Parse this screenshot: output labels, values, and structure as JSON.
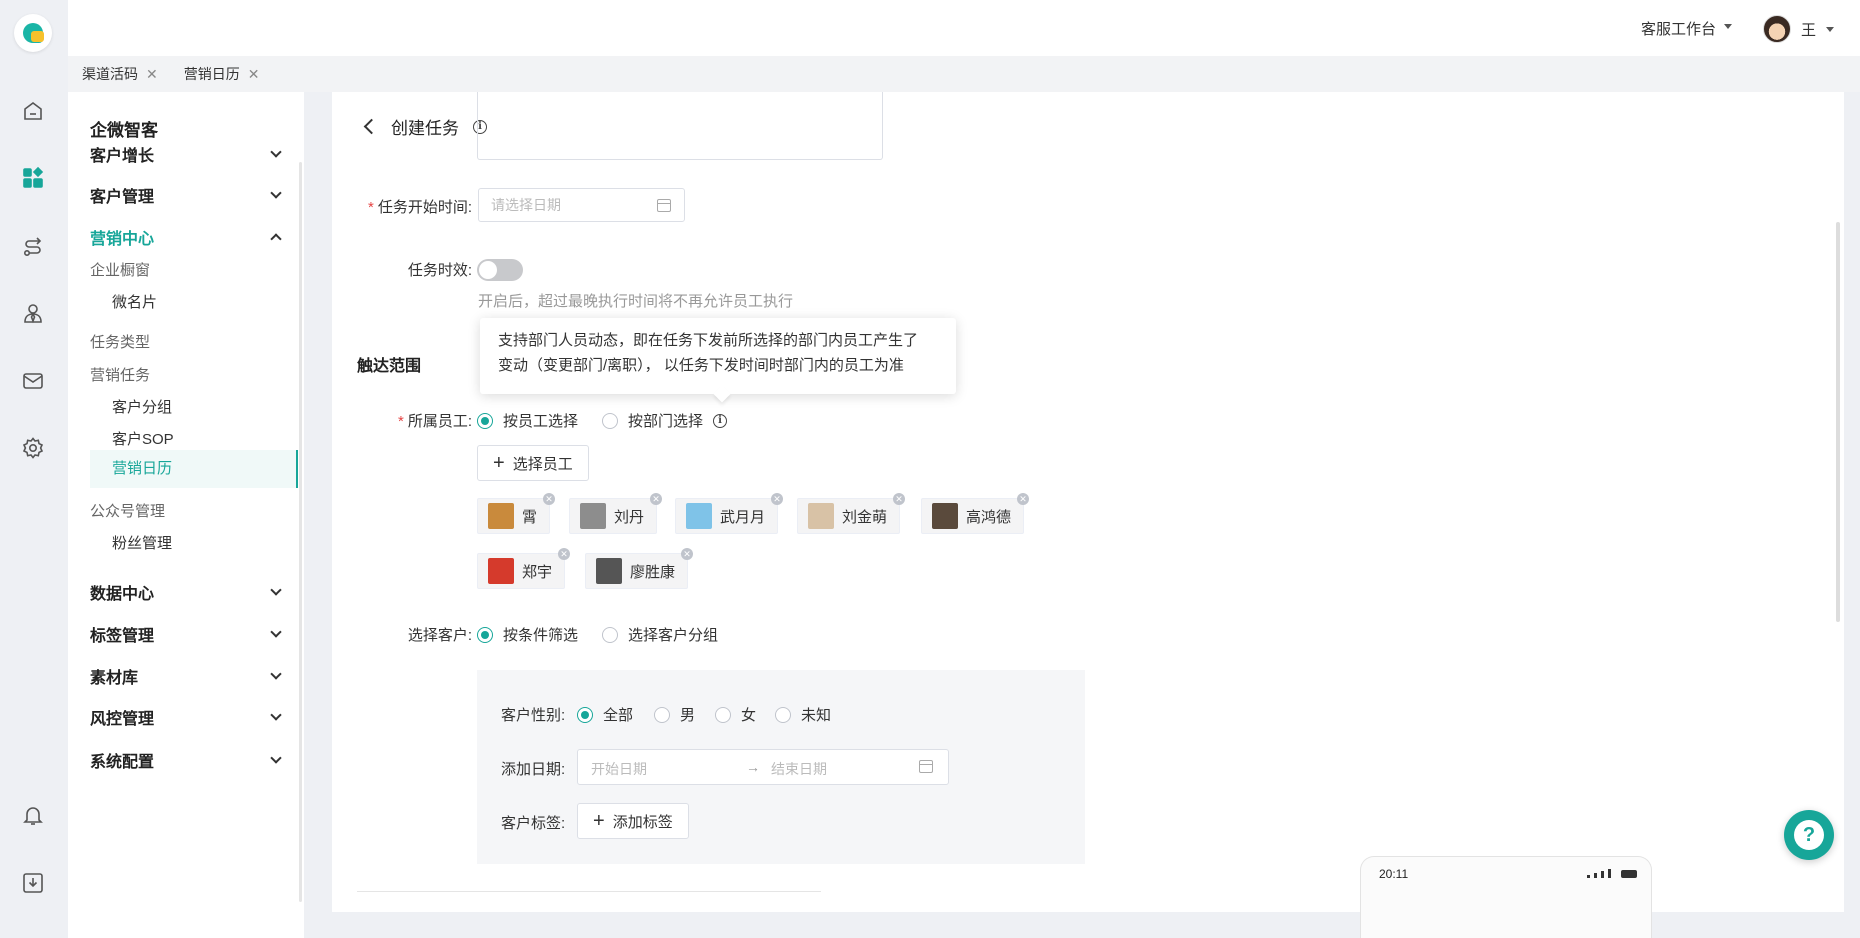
{
  "topbar": {
    "workspace": "客服工作台",
    "user_name": "王"
  },
  "tabs": [
    {
      "label": "渠道活码"
    },
    {
      "label": "营销日历"
    }
  ],
  "sidebar": {
    "title": "企微智客",
    "items": {
      "growth": "客户增长",
      "customer_mgmt": "客户管理",
      "marketing": "营销中心",
      "showcase": "企业橱窗",
      "micro_card": "微名片",
      "task_type": "任务类型",
      "marketing_task": "营销任务",
      "customer_group": "客户分组",
      "customer_sop": "客户SOP",
      "marketing_calendar": "营销日历",
      "official_account": "公众号管理",
      "fans": "粉丝管理",
      "data_center": "数据中心",
      "tag_mgmt": "标签管理",
      "material": "素材库",
      "risk": "风控管理",
      "system": "系统配置"
    }
  },
  "page": {
    "title": "创建任务"
  },
  "form": {
    "start_time": {
      "label": "任务开始时间:",
      "placeholder": "请选择日期"
    },
    "validity": {
      "label": "任务时效:",
      "hint": "开启后，超过最晚执行时间将不再允许员工执行",
      "enabled": false
    },
    "section_scope": "触达范围",
    "tooltip": {
      "line1": "支持部门人员动态，即在任务下发前所选择的部门内员工产生了",
      "line2": "变动（变更部门/离职），  以任务下发时间时部门内的员工为准"
    },
    "staff": {
      "label": "所属员工:",
      "option_by_staff": "按员工选择",
      "option_by_dept": "按部门选择",
      "select_button": "选择员工",
      "selected": [
        {
          "name": "霄",
          "color": "#c98a3c"
        },
        {
          "name": "刘丹",
          "color": "#8d8d8d"
        },
        {
          "name": "武月月",
          "color": "#7fc3e8"
        },
        {
          "name": "刘金萌",
          "color": "#d8c2a6"
        },
        {
          "name": "高鸿德",
          "color": "#5a4a3c"
        },
        {
          "name": "郑宇",
          "color": "#d53a2c"
        },
        {
          "name": "廖胜康",
          "color": "#555555"
        }
      ]
    },
    "customer": {
      "label": "选择客户:",
      "option_filter": "按条件筛选",
      "option_group": "选择客户分组",
      "gender": {
        "label": "客户性别:",
        "options": [
          "全部",
          "男",
          "女",
          "未知"
        ],
        "selected": "全部"
      },
      "date": {
        "label": "添加日期:",
        "start_placeholder": "开始日期",
        "end_placeholder": "结束日期",
        "separator": "→"
      },
      "tags": {
        "label": "客户标签:",
        "add_button": "添加标签"
      }
    }
  },
  "phone_preview": {
    "time": "20:11"
  },
  "colors": {
    "accent": "#17a699",
    "required": "#e54545"
  }
}
